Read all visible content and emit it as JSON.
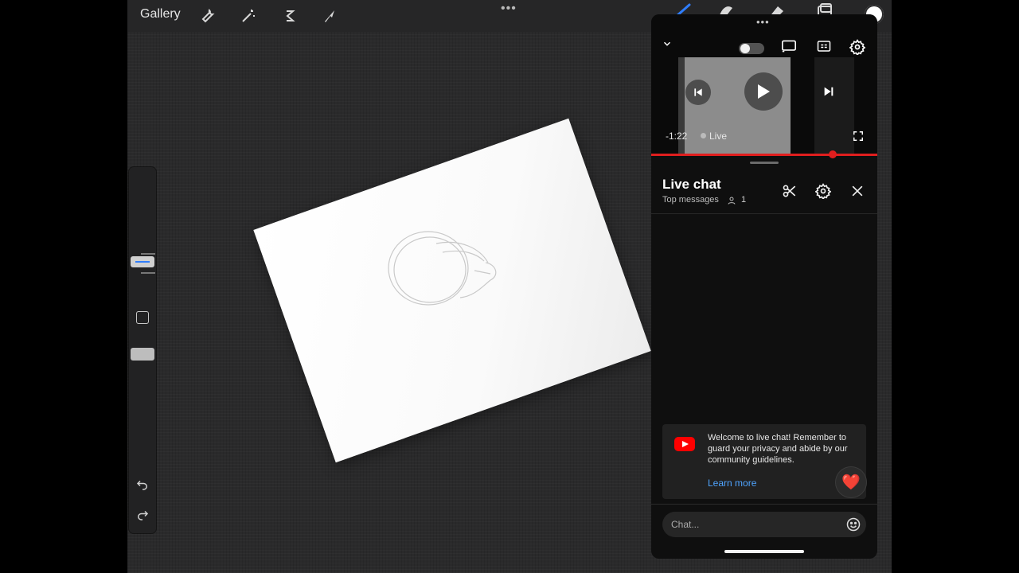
{
  "procreate": {
    "gallery_label": "Gallery",
    "top_tools": [
      "wrench-icon",
      "magic-wand-icon",
      "selection-icon",
      "transform-arrow-icon"
    ],
    "right_tools": [
      "brush-icon",
      "smudge-icon",
      "eraser-icon",
      "layers-icon",
      "color-dot"
    ],
    "color": "#ffffff"
  },
  "youtube_pip": {
    "time_remaining": "-1:22",
    "live_label": "Live",
    "progress_fraction": 0.8,
    "chat": {
      "title": "Live chat",
      "subtitle": "Top messages",
      "viewer_count": "1",
      "welcome_message": "Welcome to live chat! Remember to guard your privacy and abide by our community guidelines.",
      "learn_more": "Learn more",
      "input_placeholder": "Chat...",
      "heart_emoji": "❤️"
    }
  },
  "colors": {
    "youtube_red": "#ff0000",
    "progress_red": "#e01e1e",
    "link_blue": "#4fa4ff",
    "slider_accent": "#2f7dfc"
  }
}
